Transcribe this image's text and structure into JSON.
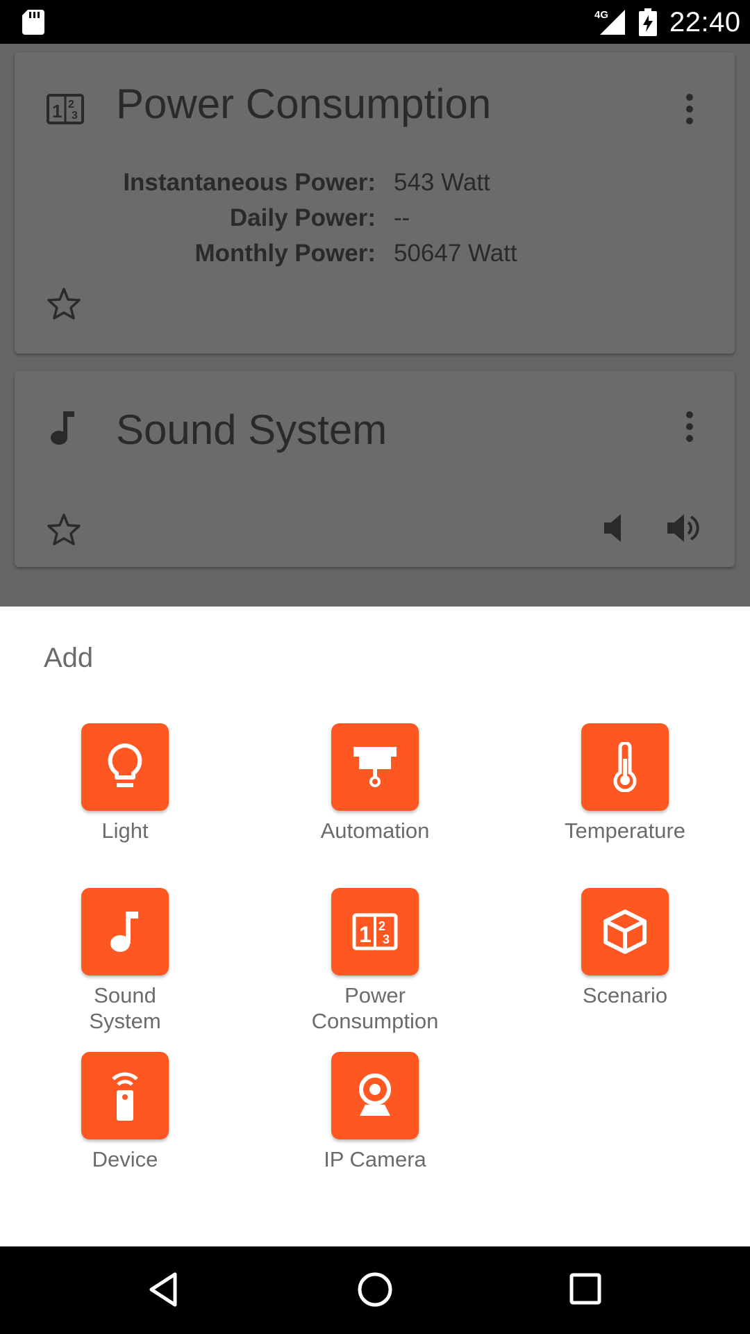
{
  "status_bar": {
    "network": "4G",
    "time": "22:40"
  },
  "cards": {
    "power": {
      "title": "Power Consumption",
      "rows": [
        {
          "label": "Instantaneous Power:",
          "value": "543 Watt"
        },
        {
          "label": "Daily Power:",
          "value": "--"
        },
        {
          "label": "Monthly Power:",
          "value": "50647 Watt"
        }
      ]
    },
    "sound": {
      "title": "Sound System"
    }
  },
  "sheet": {
    "title": "Add",
    "items": [
      {
        "label": "Light",
        "icon": "lightbulb-icon"
      },
      {
        "label": "Automation",
        "icon": "projector-screen-icon"
      },
      {
        "label": "Temperature",
        "icon": "thermometer-icon"
      },
      {
        "label": "Sound\nSystem",
        "icon": "music-note-icon"
      },
      {
        "label": "Power\nConsumption",
        "icon": "counter-icon"
      },
      {
        "label": "Scenario",
        "icon": "cube-icon"
      },
      {
        "label": "Device",
        "icon": "remote-icon"
      },
      {
        "label": "IP Camera",
        "icon": "webcam-icon"
      }
    ]
  },
  "colors": {
    "accent": "#ff5722",
    "scrim": "#666666",
    "text_dark": "#2a2a2a",
    "text_gray": "#6b6b6b"
  }
}
